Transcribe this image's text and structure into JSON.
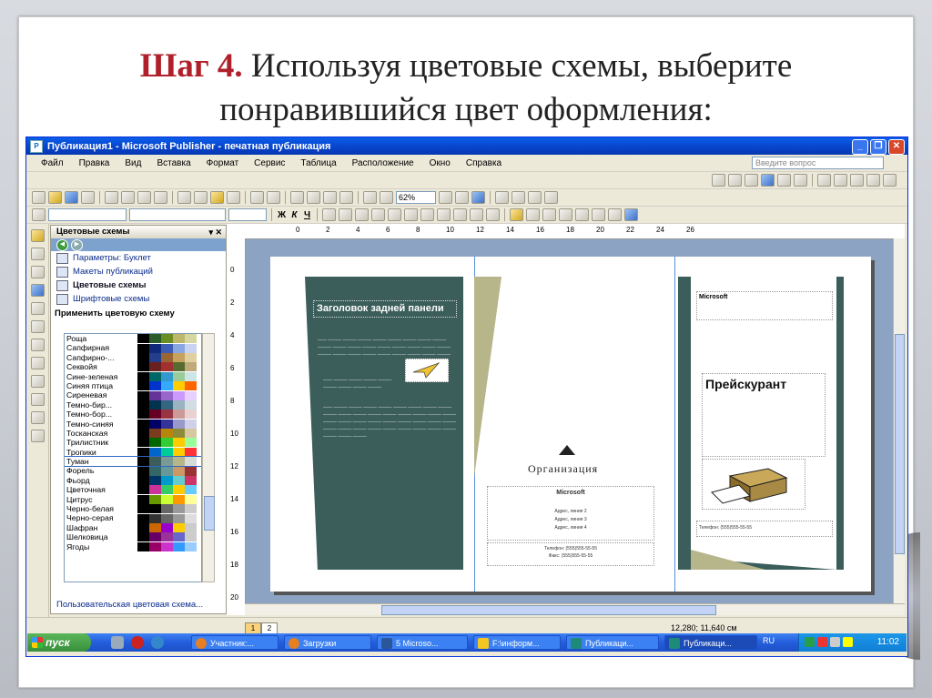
{
  "slide": {
    "step": "Шаг 4.",
    "title_rest": " Используя цветовые схемы, выберите понравившийся цвет оформления:"
  },
  "window": {
    "title": "Публикация1 - Microsoft Publisher - печатная публикация",
    "menu": [
      "Файл",
      "Правка",
      "Вид",
      "Вставка",
      "Формат",
      "Сервис",
      "Таблица",
      "Расположение",
      "Окно",
      "Справка"
    ],
    "help_placeholder": "Введите вопрос",
    "zoom": "62%"
  },
  "task_pane": {
    "title": "Цветовые схемы",
    "links": [
      {
        "label": "Параметры: Буклет",
        "icon": "options-icon"
      },
      {
        "label": "Макеты публикаций",
        "icon": "layouts-icon"
      },
      {
        "label": "Цветовые схемы",
        "icon": "color-schemes-icon"
      },
      {
        "label": "Шрифтовые схемы",
        "icon": "font-schemes-icon"
      }
    ],
    "apply_label": "Применить цветовую схему",
    "schemes": [
      {
        "name": "Роща",
        "colors": [
          "#000000",
          "#2a5d2a",
          "#6b8e23",
          "#bdb76b",
          "#d6d6a0"
        ]
      },
      {
        "name": "Сапфирная",
        "colors": [
          "#000000",
          "#0f2a7a",
          "#3b5bb5",
          "#8aa6e0",
          "#c7d3f0"
        ]
      },
      {
        "name": "Сапфирно-...",
        "colors": [
          "#000000",
          "#233e8b",
          "#996633",
          "#c7a25e",
          "#e0d0a0"
        ]
      },
      {
        "name": "Секвойя",
        "colors": [
          "#000000",
          "#6b2020",
          "#a33030",
          "#556b2f",
          "#c2a97a"
        ]
      },
      {
        "name": "Сине-зеленая",
        "colors": [
          "#000000",
          "#006666",
          "#3399cc",
          "#99cc99",
          "#cce6e6"
        ]
      },
      {
        "name": "Синяя птица",
        "colors": [
          "#000000",
          "#0033cc",
          "#33aaff",
          "#ffcc00",
          "#ff6600"
        ]
      },
      {
        "name": "Сиреневая",
        "colors": [
          "#000000",
          "#663399",
          "#9966cc",
          "#cc99ff",
          "#e6d0ff"
        ]
      },
      {
        "name": "Темно-бир...",
        "colors": [
          "#000000",
          "#00334d",
          "#336680",
          "#99b3c0",
          "#d0dde3"
        ]
      },
      {
        "name": "Темно-бор...",
        "colors": [
          "#000000",
          "#660022",
          "#993344",
          "#cc9999",
          "#ead0d0"
        ]
      },
      {
        "name": "Темно-синяя",
        "colors": [
          "#000000",
          "#000066",
          "#333399",
          "#9999cc",
          "#d0d0ea"
        ]
      },
      {
        "name": "Тосканская",
        "colors": [
          "#000000",
          "#7a3b1e",
          "#b8860b",
          "#8b8b3a",
          "#d8c8a0"
        ]
      },
      {
        "name": "Трилистник",
        "colors": [
          "#000000",
          "#006600",
          "#33cc33",
          "#ffcc00",
          "#99ff99"
        ]
      },
      {
        "name": "Тропики",
        "colors": [
          "#000000",
          "#0066cc",
          "#00cc99",
          "#ffcc00",
          "#ff3333"
        ]
      },
      {
        "name": "Туман",
        "colors": [
          "#000000",
          "#3b5e5a",
          "#7a9a96",
          "#b7b58a",
          "#d6dcd8"
        ]
      },
      {
        "name": "Форель",
        "colors": [
          "#000000",
          "#336666",
          "#669999",
          "#cc9966",
          "#993333"
        ]
      },
      {
        "name": "Фьорд",
        "colors": [
          "#000000",
          "#003366",
          "#0099cc",
          "#66cccc",
          "#cc3366"
        ]
      },
      {
        "name": "Цветочная",
        "colors": [
          "#000000",
          "#cc3399",
          "#33cc66",
          "#ffcc00",
          "#66ccff"
        ]
      },
      {
        "name": "Цитрус",
        "colors": [
          "#000000",
          "#669900",
          "#ccff33",
          "#ff9900",
          "#ffff99"
        ]
      },
      {
        "name": "Черно-белая",
        "colors": [
          "#000000",
          "#000000",
          "#666666",
          "#999999",
          "#cccccc"
        ]
      },
      {
        "name": "Черно-серая",
        "colors": [
          "#000000",
          "#333333",
          "#666666",
          "#999999",
          "#dddddd"
        ]
      },
      {
        "name": "Шафран",
        "colors": [
          "#000000",
          "#cc6600",
          "#9900cc",
          "#ffcc00",
          "#cccccc"
        ]
      },
      {
        "name": "Шелковица",
        "colors": [
          "#000000",
          "#660066",
          "#993399",
          "#6666cc",
          "#cccccc"
        ]
      },
      {
        "name": "Ягоды",
        "colors": [
          "#000000",
          "#990066",
          "#cc33cc",
          "#3399ff",
          "#99ccff"
        ]
      }
    ],
    "selected": "Туман",
    "custom_link": "Пользовательская цветовая схема..."
  },
  "ruler": {
    "h": [
      "0",
      "2",
      "4",
      "6",
      "8",
      "10",
      "12",
      "14",
      "16",
      "18",
      "20",
      "22",
      "24",
      "26"
    ],
    "v": [
      "0",
      "2",
      "4",
      "6",
      "8",
      "10",
      "12",
      "14",
      "16",
      "18",
      "20"
    ]
  },
  "brochure": {
    "left_title": "Заголовок задней панели",
    "org_name": "Организация",
    "ms": "Microsoft",
    "price": "Прейскурант",
    "addr": [
      "Адрес, линия 2",
      "Адрес, линия 3",
      "Адрес, линия 4"
    ],
    "phones": [
      "Телефон: (555)555-55-55",
      "Факс: (555)555-55-55"
    ]
  },
  "status": {
    "pages": [
      "1",
      "2"
    ],
    "coords": "12,280; 11,640 см"
  },
  "taskbar": {
    "start": "пуск",
    "tasks": [
      "Участник:...",
      "Загрузки",
      "5 Microso...",
      "F:\\информ...",
      "Публикаци...",
      "Публикаци..."
    ],
    "lang": "RU",
    "time": "11:02"
  }
}
